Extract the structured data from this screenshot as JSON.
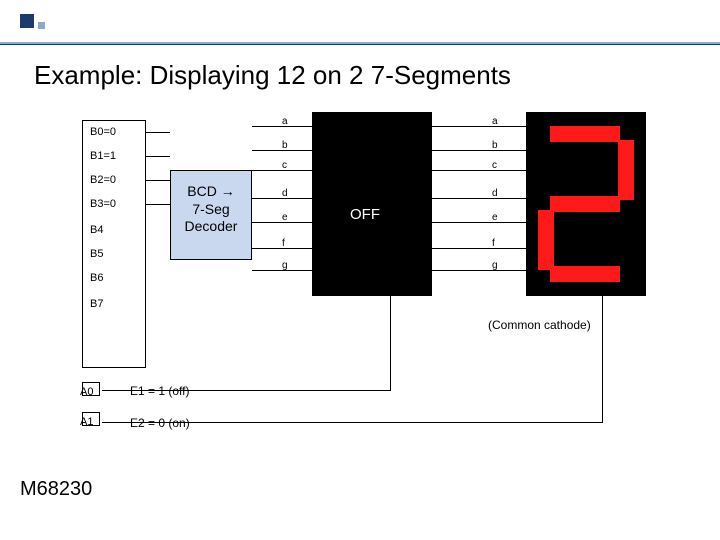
{
  "title": "Example: Displaying 12 on 2 7-Segments",
  "inputs": {
    "b0": "B0=0",
    "b1": "B1=1",
    "b2": "B2=0",
    "b3": "B3=0",
    "b4": "B4",
    "b5": "B5",
    "b6": "B6",
    "b7": "B7"
  },
  "decoder_label": "BCD →\n7-Seg\nDecoder",
  "segments_left": {
    "a": "a",
    "b": "b",
    "c": "c",
    "d": "d",
    "e": "e",
    "f": "f",
    "g": "g"
  },
  "segments_right": {
    "a": "a",
    "b": "b",
    "c": "c",
    "d": "d",
    "e": "e",
    "f": "f",
    "g": "g"
  },
  "left_display_text": "OFF",
  "right_display_digit": "2",
  "common_cathode": "(Common cathode)",
  "addr": {
    "a0": "A0",
    "a1": "A1"
  },
  "enables": {
    "e1": "E1 = 1 (off)",
    "e2": "E2 = 0 (on)"
  },
  "chip": "M68230",
  "right_display_segments_lit": [
    "a",
    "b",
    "g",
    "e",
    "d"
  ]
}
